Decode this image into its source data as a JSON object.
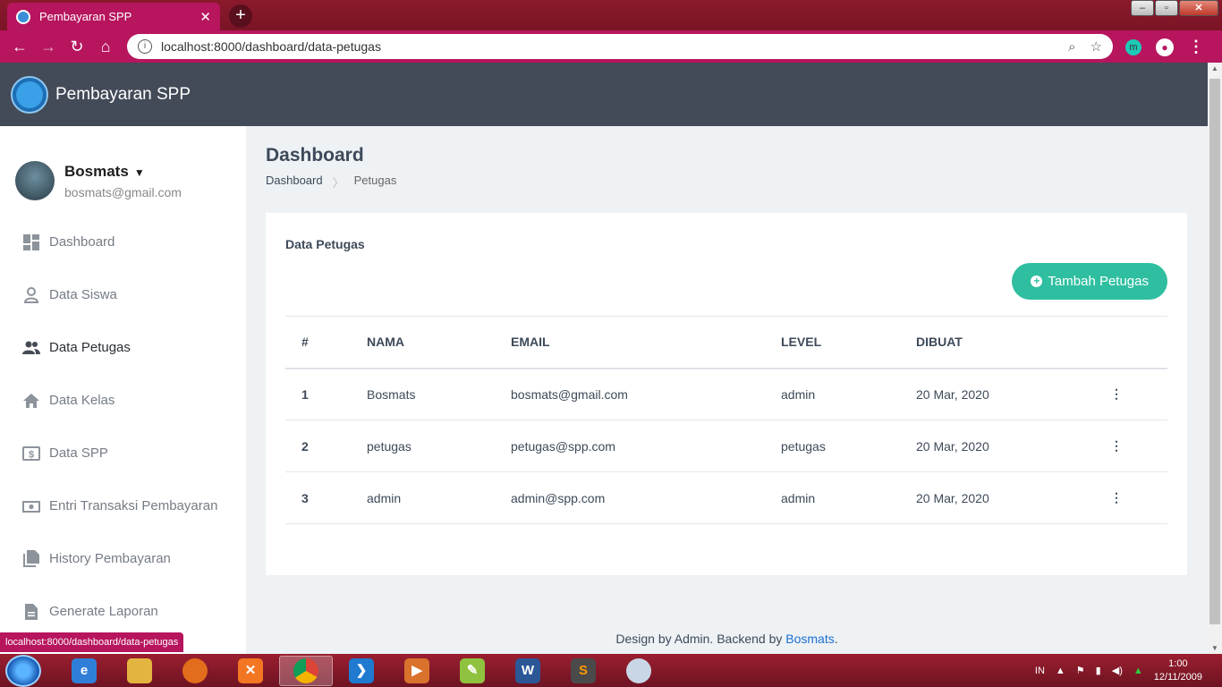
{
  "browser": {
    "tab_title": "Pembayaran SPP",
    "tab_close": "✕",
    "new_tab": "+",
    "url": "localhost:8000/dashboard/data-petugas",
    "status_url": "localhost:8000/dashboard/data-petugas",
    "extension_initial": "m"
  },
  "app": {
    "brand": "Pembayaran SPP"
  },
  "user": {
    "name": "Bosmats",
    "email": "bosmats@gmail.com"
  },
  "sidebar": {
    "items": [
      {
        "label": "Dashboard",
        "icon": "dashboard-icon"
      },
      {
        "label": "Data Siswa",
        "icon": "person-icon"
      },
      {
        "label": "Data Petugas",
        "icon": "people-icon",
        "active": true
      },
      {
        "label": "Data Kelas",
        "icon": "home-icon"
      },
      {
        "label": "Data SPP",
        "icon": "dollar-icon"
      },
      {
        "label": "Entri Transaksi Pembayaran",
        "icon": "money-icon"
      },
      {
        "label": "History Pembayaran",
        "icon": "files-icon"
      },
      {
        "label": "Generate Laporan",
        "icon": "document-icon"
      }
    ]
  },
  "page": {
    "title": "Dashboard",
    "breadcrumb": [
      "Dashboard",
      "Petugas"
    ]
  },
  "card": {
    "title": "Data Petugas",
    "add_button": "Tambah Petugas",
    "columns": [
      "#",
      "NAMA",
      "EMAIL",
      "LEVEL",
      "DIBUAT"
    ],
    "rows": [
      {
        "no": "1",
        "nama": "Bosmats",
        "email": "bosmats@gmail.com",
        "level": "admin",
        "dibuat": "20 Mar, 2020"
      },
      {
        "no": "2",
        "nama": "petugas",
        "email": "petugas@spp.com",
        "level": "petugas",
        "dibuat": "20 Mar, 2020"
      },
      {
        "no": "3",
        "nama": "admin",
        "email": "admin@spp.com",
        "level": "admin",
        "dibuat": "20 Mar, 2020"
      }
    ]
  },
  "footer": {
    "text": "Design by Admin. Backend by ",
    "link": "Bosmats",
    "end": "."
  },
  "taskbar": {
    "lang": "IN",
    "time": "1:00",
    "date": "12/11/2009"
  },
  "colors": {
    "accent": "#b7155e",
    "header": "#434a58",
    "button": "#2fbfa0"
  }
}
